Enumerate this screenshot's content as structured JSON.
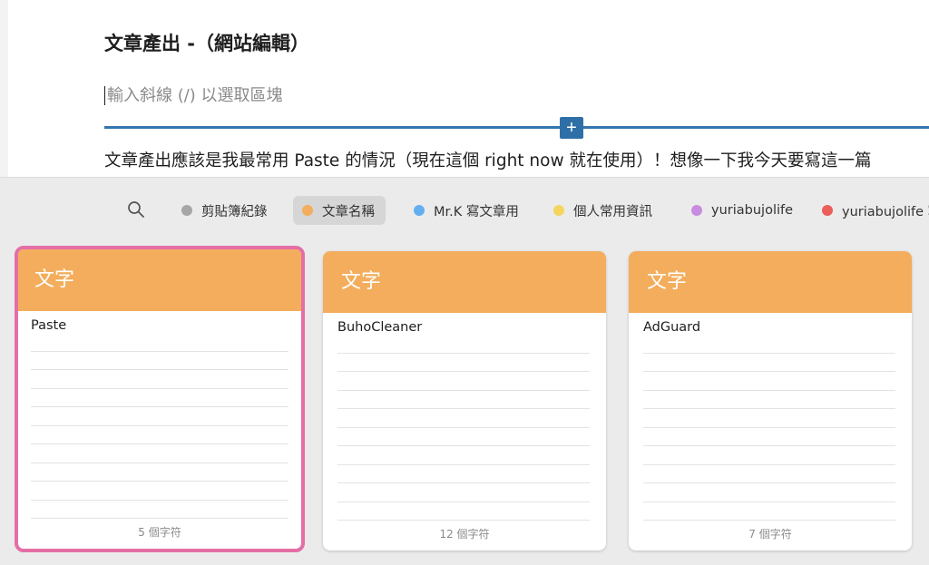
{
  "editor": {
    "heading": "文章產出 -（網站編輯）",
    "block_placeholder": "輸入斜線 (/) 以選取區塊",
    "inserter_label": "+",
    "paragraph": "文章產出應該是我最常用 Paste 的情況（現在這個 right now 就在使用）！想像一下我今天要寫這一篇"
  },
  "panel": {
    "search_icon": "search-icon",
    "pinboards": [
      {
        "label": "剪貼簿紀錄",
        "color": "#a6a6a6",
        "active": false
      },
      {
        "label": "文章名稱",
        "color": "#f3ad5c",
        "active": true
      },
      {
        "label": "Mr.K 寫文章用",
        "color": "#64aef0",
        "active": false
      },
      {
        "label": "個人常用資訊",
        "color": "#f5d55e",
        "active": false
      },
      {
        "label": "yuriabujolife",
        "color": "#c98be0",
        "active": false
      },
      {
        "label": "yuriabujolife 寫",
        "color": "#ea5f58",
        "active": false
      }
    ],
    "cards": [
      {
        "type": "文字",
        "text": "Paste",
        "count": "5 個字符",
        "selected": true
      },
      {
        "type": "文字",
        "text": "BuhoCleaner",
        "count": "12 個字符",
        "selected": false
      },
      {
        "type": "文字",
        "text": "AdGuard",
        "count": "7 個字符",
        "selected": false
      }
    ],
    "colors": {
      "card_header": "#f3ad5c",
      "selection": "#e46fa6",
      "accent": "#2f6fa7"
    }
  }
}
